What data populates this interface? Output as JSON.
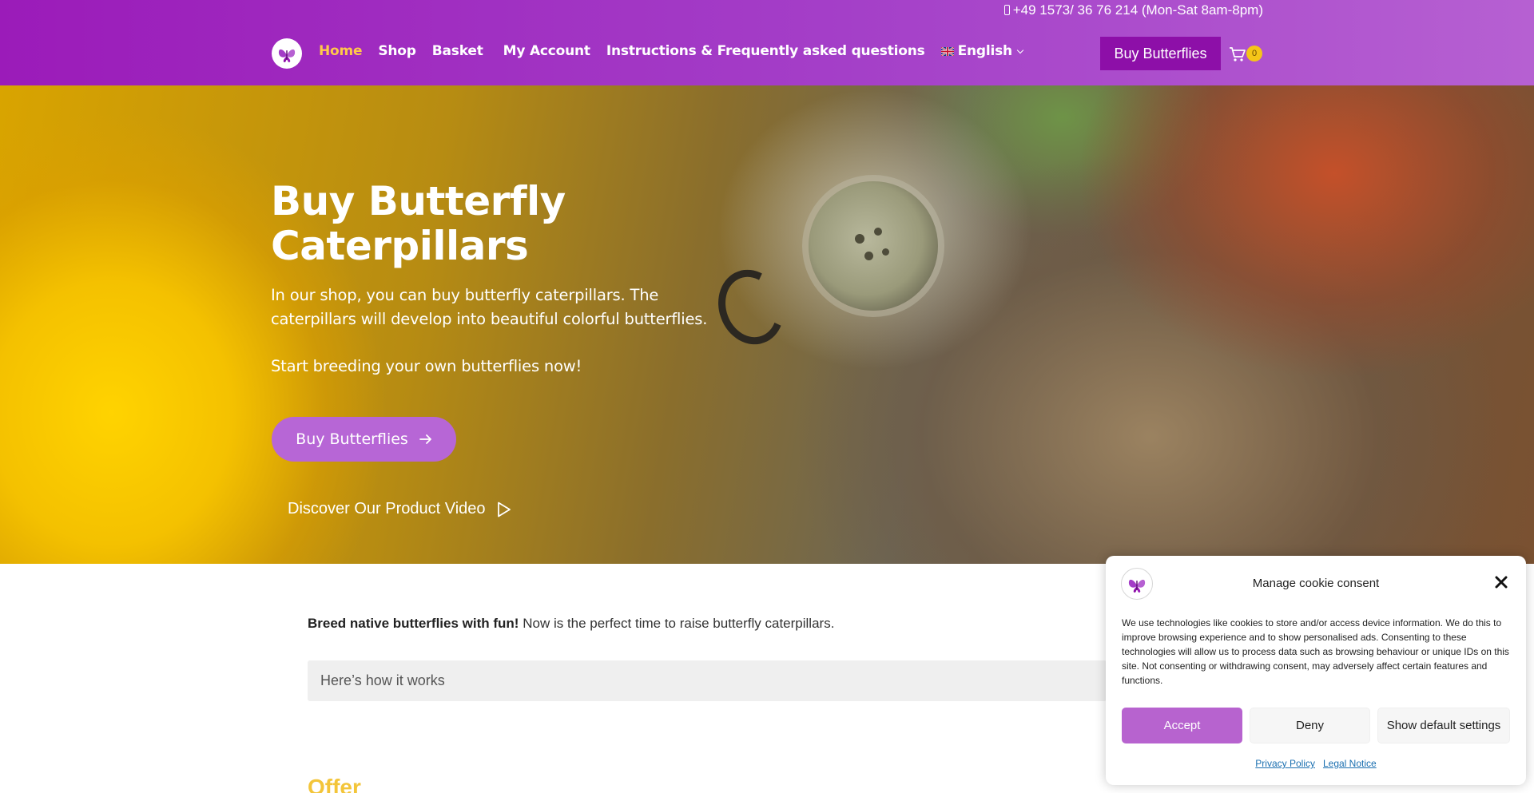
{
  "header": {
    "phone": "+49 1573/ 36 76 214 (Mon-Sat 8am-8pm)",
    "nav": [
      {
        "label": "Home",
        "active": true
      },
      {
        "label": "Shop"
      },
      {
        "label": "Basket"
      },
      {
        "label": "My Account"
      },
      {
        "label": "Instructions & Frequently asked questions"
      }
    ],
    "language": "English",
    "cta_label": "Buy Butterflies",
    "cart_count": "0",
    "icons": [
      "butterfly-logo-icon",
      "uk-flag-icon",
      "chevron-down-icon",
      "cart-icon",
      "phone-icon"
    ]
  },
  "hero": {
    "title": "Buy Butterfly Caterpillars",
    "text": "In our shop, you can buy butterfly caterpillars. The caterpillars will develop into beautiful colorful butterflies.",
    "text2": "Start breeding your own butterflies now!",
    "cta_label": "Buy Butterflies",
    "video_label": "Discover Our Product Video"
  },
  "content": {
    "intro_bold": "Breed native butterflies with fun!",
    "intro_rest": " Now is the perfect time to raise butterfly caterpillars.",
    "accordion_label": "Here’s how it works",
    "offer_heading": "Offer"
  },
  "cookie": {
    "title": "Manage cookie consent",
    "text": "We use technologies like cookies to store and/or access device information. We do this to improve browsing experience and to show personalised ads. Consenting to these technologies will allow us to process data such as browsing behaviour or unique IDs on this site. Not consenting or withdrawing consent, may adversely affect certain features and functions.",
    "accept": "Accept",
    "deny": "Deny",
    "settings": "Show default settings",
    "privacy": "Privacy Policy",
    "legal": "Legal Notice"
  },
  "colors": {
    "header_purple": "#9b1bb9",
    "header_button": "#8d0fa8",
    "active_nav": "#ffc94a",
    "hero_button": "#b766d6",
    "accept_button": "#b763cf",
    "offer_heading": "#f3c53a",
    "cart_badge": "#f5c518"
  }
}
